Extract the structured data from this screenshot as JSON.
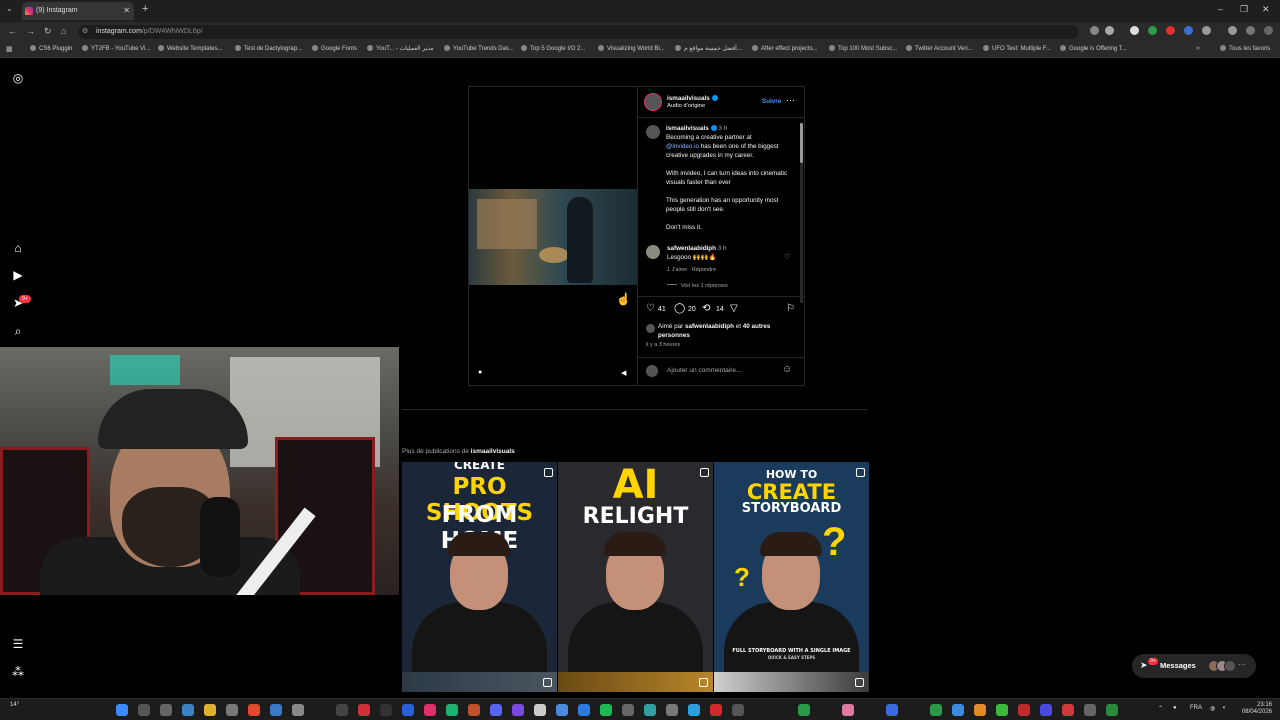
{
  "browser": {
    "tab_title": "(9) Instagram",
    "url_domain": "instagram.com",
    "url_path": "/p/DW4WhiWDL6p/",
    "bookmarks": [
      "CS6 Pluggin",
      "YT2FB - YouTube Vi...",
      "Website Templates...",
      "Test de Dactylograp...",
      "Google Fonts",
      "YouT... - مدير العمليات",
      "YouTube Trends Das...",
      "Top 5 Google I/O 2...",
      "Visualizing World Bi...",
      "أفضل خمسة مواقع م...",
      "After effect projects...",
      "Top 100 Most Subsc...",
      "Twitter Account Veri...",
      "UFO Test: Multiple F...",
      "Google is Offering T..."
    ],
    "all_favorites": "Tous les favoris"
  },
  "sidebar": {
    "notification_count": "9+"
  },
  "post": {
    "header": {
      "username": "ismaailvisuals",
      "audio": "Audio d'origine",
      "follow_label": "Suivre",
      "more_icon": "more-horizontal-icon"
    },
    "caption": {
      "username": "ismaailvisuals",
      "time": "3 h",
      "line1": "Becoming a creative partner at",
      "mention": "@invideo.io",
      "line2": "has been one of the biggest creative upgrades in my career.",
      "para2": "With invideo, I can turn ideas into cinematic visuals faster than ever",
      "para3": "This generation has an opportunity most people still don't see.",
      "para4": "Don't miss it."
    },
    "comment": {
      "username": "safwenlaabidiph",
      "time": "3 h",
      "text": "Lesgooo 🙌🙌🔥",
      "likes": "1 J'aime",
      "reply": "Répondre",
      "view_replies": "Voir les 1 réponses"
    },
    "actions": {
      "likes": "41",
      "comments": "20",
      "reposts": "14"
    },
    "liked_by": {
      "prefix": "Aimé par",
      "user": "safwenlaabidiph",
      "middle": "et",
      "others": "40 autres personnes"
    },
    "time_ago": "il y a 3 heures",
    "comment_placeholder": "Ajouter un commentaire..."
  },
  "more_posts": {
    "label_prefix": "Plus de publications de",
    "label_user": "ismaailvisuals",
    "thumbs": [
      {
        "line1": "CREATE",
        "line2": "PRO SHOOTS",
        "line3": "FROM HOME",
        "bg": "#1b2738"
      },
      {
        "line1": "AI",
        "line2": "RELIGHT",
        "line3": "",
        "bg": "#2a2a2e"
      },
      {
        "line1": "HOW TO",
        "line2": "CREATE",
        "line3": "STORYBOARD",
        "sub": "FULL STORYBOARD WITH A SINGLE IMAGE",
        "sub2": "QUICK & EASY STEPS",
        "bg": "#1a3b5c"
      }
    ]
  },
  "messages": {
    "label": "Messages",
    "badge": "9+"
  },
  "taskbar": {
    "time": "23:16",
    "date": "08/04/2026",
    "lang": "FRA",
    "temp": "14°"
  },
  "colors": {
    "accent": "#0095f6",
    "badge": "#ff3040",
    "create_yellow": "#ffd400"
  }
}
